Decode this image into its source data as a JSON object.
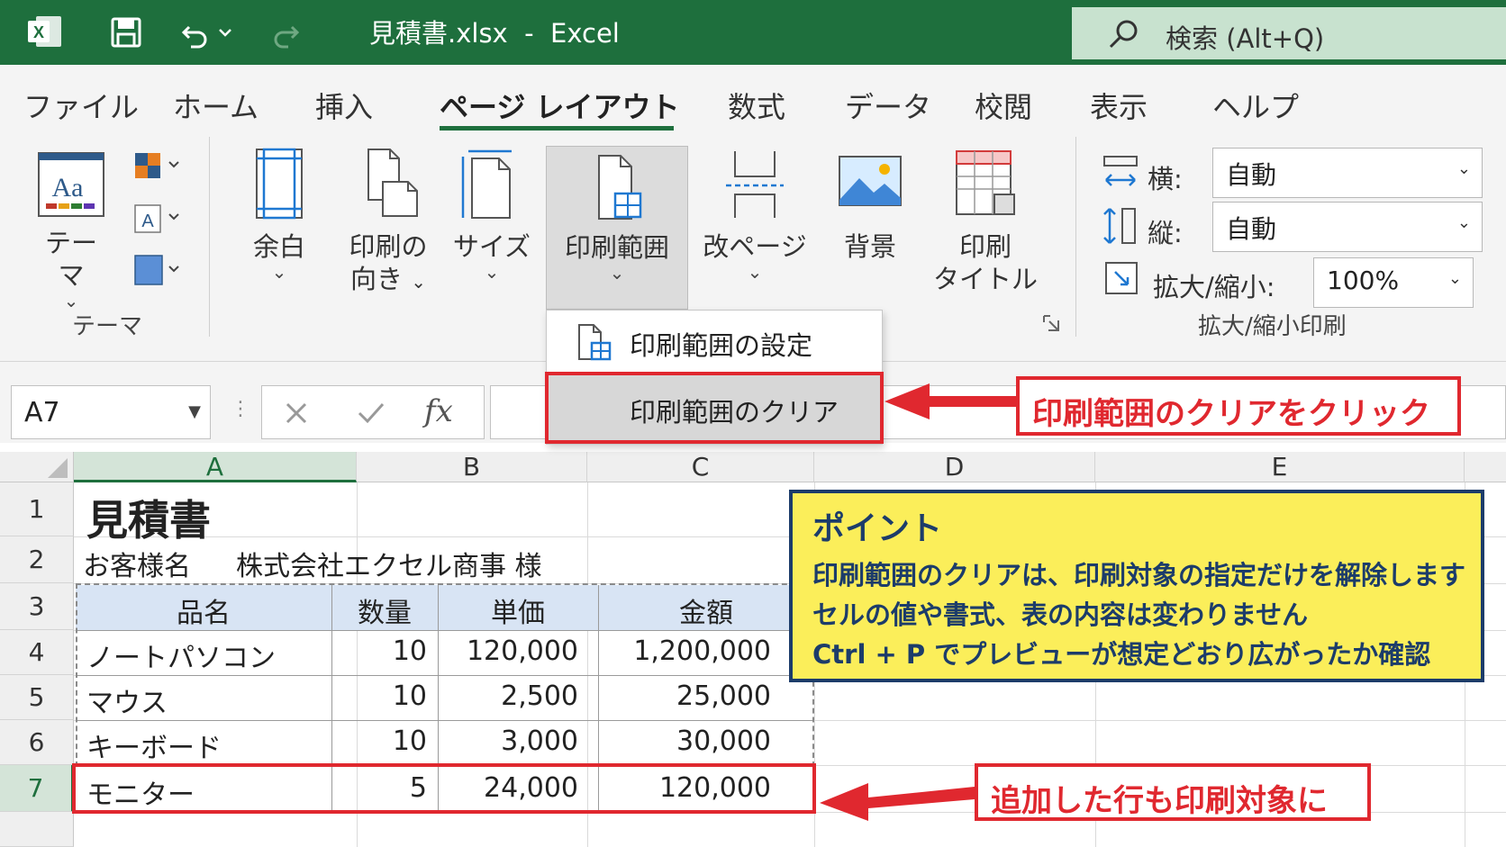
{
  "titlebar": {
    "title": "見積書.xlsx  -  Excel",
    "search_placeholder": "検索 (Alt+Q)"
  },
  "tabs": [
    "ファイル",
    "ホーム",
    "挿入",
    "ページ レイアウト",
    "数式",
    "データ",
    "校閲",
    "表示",
    "ヘルプ"
  ],
  "ribbon": {
    "theme_label": "テーマ",
    "theme_group_label": "テーマ",
    "margins_label": "余白",
    "orientation_label_1": "印刷の",
    "orientation_label_2": "向き",
    "size_label": "サイズ",
    "print_area_label": "印刷範囲",
    "breaks_label": "改ページ",
    "background_label": "背景",
    "print_titles_label_1": "印刷",
    "print_titles_label_2": "タイトル",
    "scale": {
      "width_label": "横:",
      "width_value": "自動",
      "height_label": "縦:",
      "height_value": "自動",
      "scale_label": "拡大/縮小:",
      "scale_value": "100%",
      "group_label": "拡大/縮小印刷"
    }
  },
  "menu": {
    "set_print_area": "印刷範囲の設定",
    "clear_print_area": "印刷範囲のクリア"
  },
  "formula_bar": {
    "name_box": "A7",
    "fx": "fx"
  },
  "sheet": {
    "columns": [
      "A",
      "B",
      "C",
      "D",
      "E"
    ],
    "rows": [
      "1",
      "2",
      "3",
      "4",
      "5",
      "6",
      "7"
    ],
    "title": "見積書",
    "customer_label": "お客様名",
    "customer_value": "株式会社エクセル商事 様",
    "headers": [
      "品名",
      "数量",
      "単価",
      "金額"
    ],
    "items": [
      {
        "name": "ノートパソコン",
        "qty": "10",
        "price": "120,000",
        "amount": "1,200,000"
      },
      {
        "name": "マウス",
        "qty": "10",
        "price": "2,500",
        "amount": "25,000"
      },
      {
        "name": "キーボード",
        "qty": "10",
        "price": "3,000",
        "amount": "30,000"
      },
      {
        "name": "モニター",
        "qty": "5",
        "price": "24,000",
        "amount": "120,000"
      }
    ]
  },
  "callouts": {
    "click_clear": "印刷範囲のクリアをクリック",
    "added_row": "追加した行も印刷対象に",
    "point_title": "ポイント",
    "point_lines": [
      "印刷範囲のクリアは、印刷対象の指定だけを解除します",
      "セルの値や書式、表の内容は変わりません",
      "Ctrl + P でプレビューが想定どおり広がったか確認"
    ]
  },
  "colors": {
    "excel_green": "#1e6f3d",
    "highlight_red": "#e0282f",
    "point_yellow": "#fbee5a",
    "point_navy": "#1c3c6a",
    "table_header_blue": "#d8e4f4"
  }
}
